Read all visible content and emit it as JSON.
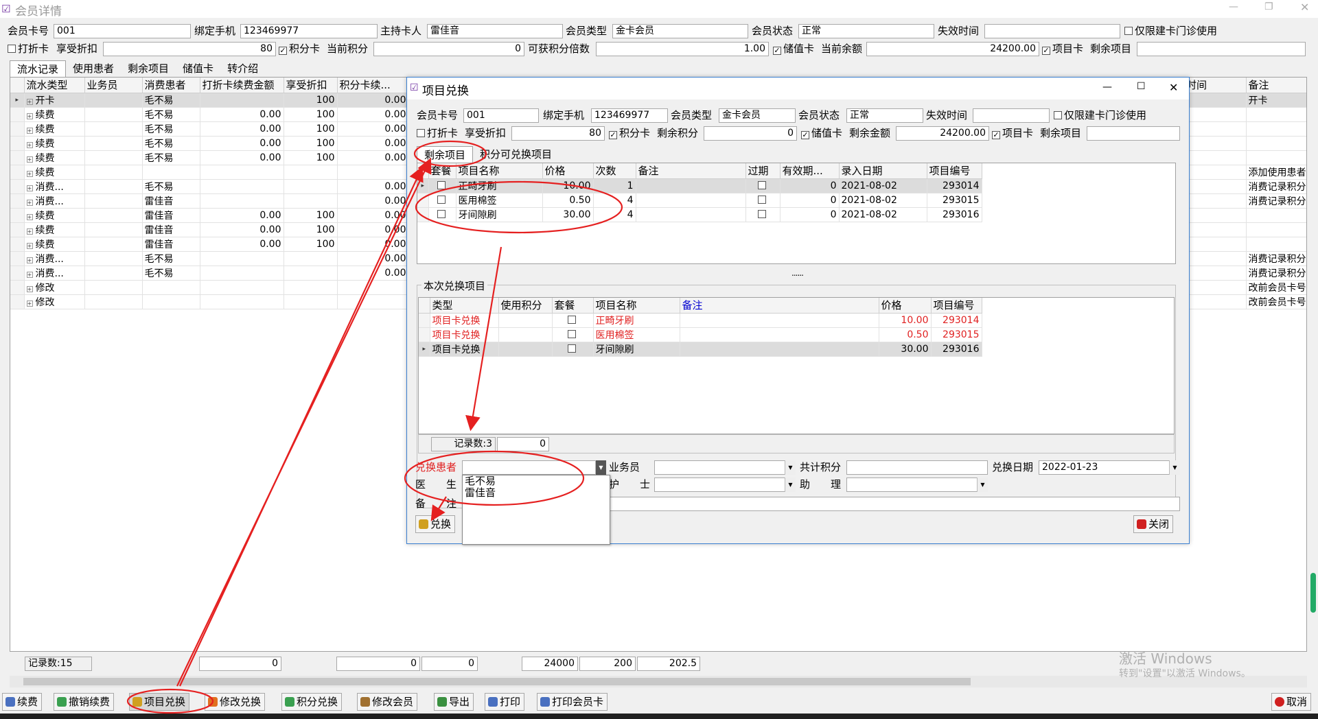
{
  "app": {
    "title": "会员详情"
  },
  "member": {
    "card_no_label": "会员卡号",
    "card_no": "001",
    "phone_label": "绑定手机",
    "phone": "123469977",
    "holder_label": "主持卡人",
    "holder": "雷佳音",
    "type_label": "会员类型",
    "type": "金卡会员",
    "status_label": "会员状态",
    "status": "正常",
    "expire_label": "失效时间",
    "expire": "",
    "clinic_only": "仅限建卡门诊使用",
    "discount_card": "打折卡",
    "discount_label": "享受折扣",
    "discount": "80",
    "points_card": "积分卡",
    "points_label": "当前积分",
    "points": "0",
    "multiplier_label": "可获积分倍数",
    "multiplier": "1.00",
    "stored_card": "储值卡",
    "balance_label": "当前余额",
    "balance": "24200.00",
    "item_card": "项目卡",
    "remain_label": "剩余项目",
    "remain": ""
  },
  "tabs": [
    "流水记录",
    "使用患者",
    "剩余项目",
    "储值卡",
    "转介绍"
  ],
  "ledger": {
    "columns": [
      "流水类型",
      "业务员",
      "消费患者",
      "打折卡续费金额",
      "享受折扣",
      "积分卡续..."
    ],
    "right_columns": [
      "时间",
      "备注"
    ],
    "rows": [
      {
        "type": "开卡",
        "staff": "",
        "patient": "毛不易",
        "amount": "",
        "discount": "100",
        "points": "0.00",
        "note": "开卡"
      },
      {
        "type": "续费",
        "staff": "",
        "patient": "毛不易",
        "amount": "0.00",
        "discount": "100",
        "points": "0.00",
        "note": ""
      },
      {
        "type": "续费",
        "staff": "",
        "patient": "毛不易",
        "amount": "0.00",
        "discount": "100",
        "points": "0.00",
        "note": ""
      },
      {
        "type": "续费",
        "staff": "",
        "patient": "毛不易",
        "amount": "0.00",
        "discount": "100",
        "points": "0.00",
        "note": ""
      },
      {
        "type": "续费",
        "staff": "",
        "patient": "毛不易",
        "amount": "0.00",
        "discount": "100",
        "points": "0.00",
        "note": ""
      },
      {
        "type": "续费",
        "staff": "",
        "patient": "",
        "amount": "",
        "discount": "",
        "points": "",
        "note": "添加使用患者"
      },
      {
        "type": "消费...",
        "staff": "",
        "patient": "毛不易",
        "amount": "",
        "discount": "",
        "points": "0.00",
        "note": "消费记录积分"
      },
      {
        "type": "消费...",
        "staff": "",
        "patient": "雷佳音",
        "amount": "",
        "discount": "",
        "points": "0.00",
        "note": "消费记录积分"
      },
      {
        "type": "续费",
        "staff": "",
        "patient": "雷佳音",
        "amount": "0.00",
        "discount": "100",
        "points": "0.00",
        "note": ""
      },
      {
        "type": "续费",
        "staff": "",
        "patient": "雷佳音",
        "amount": "0.00",
        "discount": "100",
        "points": "0.00",
        "note": ""
      },
      {
        "type": "续费",
        "staff": "",
        "patient": "雷佳音",
        "amount": "0.00",
        "discount": "100",
        "points": "0.00",
        "note": ""
      },
      {
        "type": "消费...",
        "staff": "",
        "patient": "毛不易",
        "amount": "",
        "discount": "",
        "points": "0.00",
        "note": "消费记录积分"
      },
      {
        "type": "消费...",
        "staff": "",
        "patient": "毛不易",
        "amount": "",
        "discount": "",
        "points": "0.00",
        "note": "消费记录积分"
      },
      {
        "type": "修改",
        "staff": "",
        "patient": "",
        "amount": "",
        "discount": "",
        "points": "",
        "note": "改前会员卡号"
      },
      {
        "type": "修改",
        "staff": "",
        "patient": "",
        "amount": "",
        "discount": "",
        "points": "",
        "note": "改前会员卡号"
      }
    ]
  },
  "footer": {
    "record_count": "记录数:15",
    "sum1": "0",
    "sum2": "0",
    "sum3": "0",
    "sum4": "24000",
    "sum5": "200",
    "sum6": "202.5"
  },
  "toolbar": [
    "续费",
    "撤销续费",
    "项目兑换",
    "修改兑换",
    "积分兑换",
    "修改会员",
    "导出",
    "打印",
    "打印会员卡"
  ],
  "cancel_label": "取消",
  "watermark": {
    "line1": "激活 Windows",
    "line2": "转到\"设置\"以激活 Windows。"
  },
  "dialog": {
    "title": "项目兑换",
    "card_no_label": "会员卡号",
    "card_no": "001",
    "phone_label": "绑定手机",
    "phone": "123469977",
    "type_label": "会员类型",
    "type": "金卡会员",
    "status_label": "会员状态",
    "status": "正常",
    "expire_label": "失效时间",
    "expire": "",
    "clinic_only": "仅限建卡门诊使用",
    "discount_card": "打折卡",
    "discount_label": "享受折扣",
    "discount": "80",
    "points_card": "积分卡",
    "points_label": "剩余积分",
    "points": "0",
    "stored_card": "储值卡",
    "balance_label": "剩余金额",
    "balance": "24200.00",
    "item_card": "项目卡",
    "remain_label": "剩余项目",
    "remain": "",
    "tabs": [
      "剩余项目",
      "积分可兑换项目"
    ],
    "remain_columns": [
      "套餐",
      "项目名称",
      "价格",
      "次数",
      "备注",
      "过期",
      "有效期...",
      "录入日期",
      "项目编号"
    ],
    "remain_rows": [
      {
        "name": "正畸牙刷",
        "price": "10.00",
        "count": "1",
        "note": "",
        "valid": "0",
        "date": "2021-08-02",
        "code": "293014"
      },
      {
        "name": "医用棉签",
        "price": "0.50",
        "count": "4",
        "note": "",
        "valid": "0",
        "date": "2021-08-02",
        "code": "293015"
      },
      {
        "name": "牙间隙刷",
        "price": "30.00",
        "count": "4",
        "note": "",
        "valid": "0",
        "date": "2021-08-02",
        "code": "293016"
      }
    ],
    "splitter": "......",
    "exchange_title": "本次兑换项目",
    "exchange_columns": [
      "类型",
      "使用积分",
      "套餐",
      "项目名称",
      "备注",
      "价格",
      "项目编号"
    ],
    "exchange_rows": [
      {
        "type": "项目卡兑换",
        "points": "",
        "name": "正畸牙刷",
        "note": "",
        "price": "10.00",
        "code": "293014"
      },
      {
        "type": "项目卡兑换",
        "points": "",
        "name": "医用棉签",
        "note": "",
        "price": "0.50",
        "code": "293015"
      },
      {
        "type": "项目卡兑换",
        "points": "",
        "name": "牙间隙刷",
        "note": "",
        "price": "30.00",
        "code": "293016"
      }
    ],
    "record_count": "记录数:3",
    "record_sum": "0",
    "patient_label": "兑换患者",
    "patient": "",
    "staff_label": "业务员",
    "staff": "",
    "total_points_label": "共计积分",
    "total_points": "",
    "date_label": "兑换日期",
    "date": "2022-01-23",
    "doctor_label": "医　　生",
    "nurse_label": "护　　士",
    "assistant_label": "助　　理",
    "remark_label": "备　　注",
    "dropdown_options": [
      "毛不易",
      "雷佳音"
    ],
    "exchange_btn": "兑换",
    "close_btn": "关闭"
  }
}
